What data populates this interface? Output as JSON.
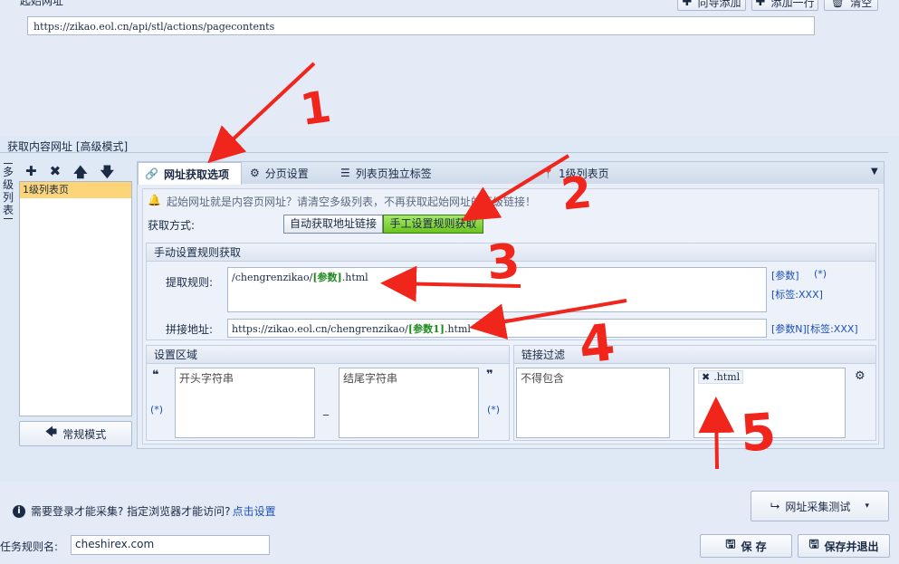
{
  "top": {
    "title_fragment": "起始网址",
    "buttons": [
      {
        "icon": "plus-icon",
        "label": "向导添加"
      },
      {
        "icon": "plus-icon",
        "label": "添加一行"
      },
      {
        "icon": "trash-icon",
        "label": "清空"
      }
    ],
    "url": "https://zikao.eol.cn/api/stl/actions/pagecontents"
  },
  "section_title": "获取内容网址 [高级模式]",
  "left": {
    "vertical_label": [
      "多",
      "级",
      "列",
      "表"
    ],
    "toolbar_icons": [
      "plus-icon",
      "close-icon",
      "arrow-up-icon",
      "arrow-down-icon"
    ],
    "items": [
      "1级列表页"
    ],
    "normal_mode_label": "常规模式"
  },
  "tabs": [
    {
      "label": "网址获取选项",
      "icon": "link-icon",
      "active": true
    },
    {
      "label": "分页设置",
      "icon": "gears-icon",
      "active": false
    },
    {
      "label": "列表页独立标签",
      "icon": "list-icon",
      "active": false
    },
    {
      "label": "1级列表页",
      "icon": "pin-icon",
      "active": false
    }
  ],
  "notice": "起始网址就是内容页网址？请清空多级列表，不再获取起始网址的下级链接！",
  "fetch_mode": {
    "label": "获取方式:",
    "options": [
      "自动获取地址链接",
      "手工设置规则获取"
    ],
    "selected": "手工设置规则获取"
  },
  "manual": {
    "header": "手动设置规则获取",
    "extract_label": "提取规则:",
    "extract_prefix": "/chengrenzikao/",
    "extract_param": "[参数]",
    "extract_suffix": ".html",
    "extract_side_1": "[参数]",
    "extract_side_2": "(*)",
    "extract_side_3": "[标签:XXX]",
    "join_label": "拼接地址:",
    "join_prefix": "https://zikao.eol.cn/chengrenzikao/",
    "join_param": "[参数1]",
    "join_suffix": ".html",
    "join_side": "[参数N][标签:XXX]"
  },
  "region": {
    "header": "设置区域",
    "open_quote": "❝",
    "close_quote": "❞",
    "wild_left": "(*)",
    "wild_right": "(*)",
    "start_placeholder": "开头字符串",
    "end_placeholder": "结尾字符串",
    "dash": "_"
  },
  "filter": {
    "header": "链接过滤",
    "exclude_placeholder": "不得包含",
    "include_tag": ".html"
  },
  "bottom": {
    "login_notice": "需要登录才能采集? 指定浏览器才能访问?",
    "login_link": "点击设置",
    "test_button": "网址采集测试",
    "task_label": "任务规则名:",
    "task_value": "cheshirex.com",
    "save": "保 存",
    "save_exit": "保存并退出"
  },
  "annotations": [
    "1",
    "2",
    "3",
    "4",
    "5"
  ]
}
